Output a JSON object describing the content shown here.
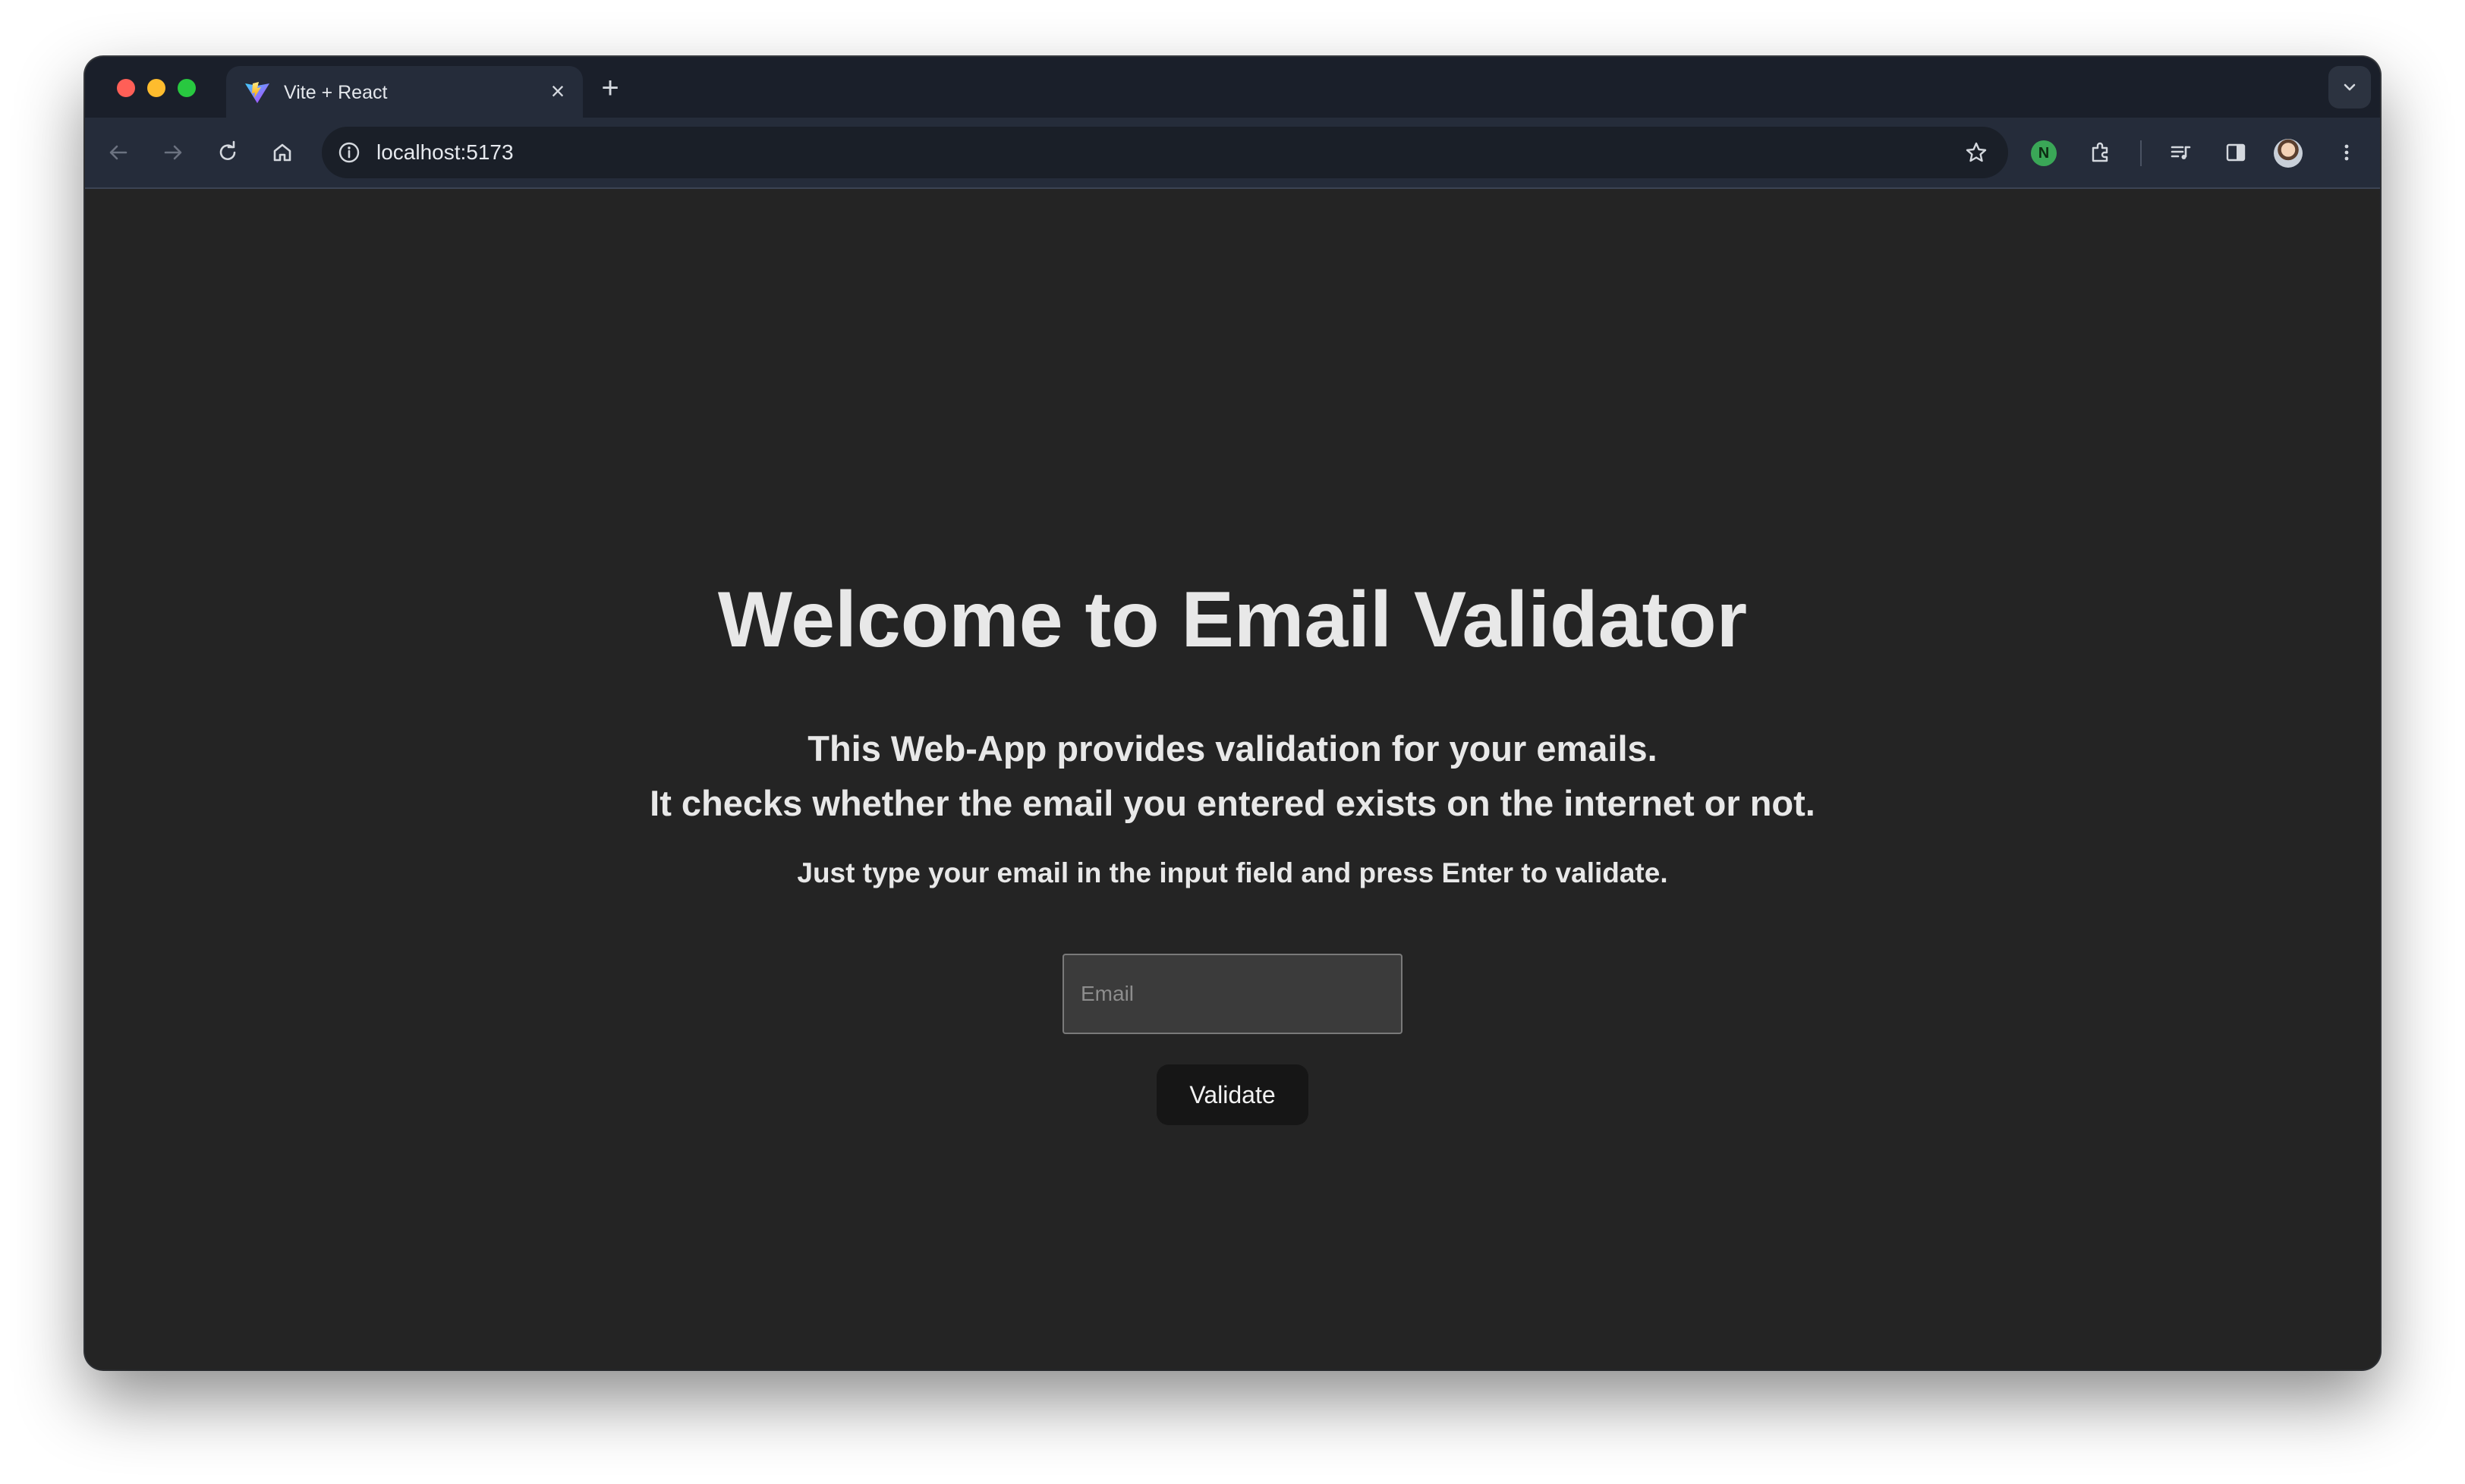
{
  "browser": {
    "tab": {
      "title": "Vite + React",
      "favicon": "vite-logo-icon",
      "close_glyph": "×"
    },
    "new_tab_glyph": "+",
    "toolbar": {
      "back_icon": "back-arrow-icon",
      "forward_icon": "forward-arrow-icon",
      "reload_icon": "reload-icon",
      "home_icon": "home-icon",
      "site_info_icon": "info-icon",
      "url": "localhost:5173",
      "bookmark_icon": "star-icon",
      "extension_badge": "N",
      "extensions_icon": "puzzle-icon",
      "media_icon": "media-queue-icon",
      "side_panel_icon": "side-panel-icon",
      "menu_icon": "kebab-menu-icon"
    },
    "colors": {
      "tabstrip": "#1a1f2a",
      "toolbar": "#252c3a",
      "omnibox": "#1a1f28"
    }
  },
  "page": {
    "title": "Welcome to Email Validator",
    "description_line1": "This Web-App provides validation for your emails.",
    "description_line2": "It checks whether the email you entered exists on the internet or not.",
    "hint": "Just type your email in the input field and press Enter to validate.",
    "email_input": {
      "placeholder": "Email",
      "value": ""
    },
    "validate_button_label": "Validate",
    "colors": {
      "background": "#242424",
      "text": "#e8e8e8",
      "button": "#161616"
    }
  }
}
